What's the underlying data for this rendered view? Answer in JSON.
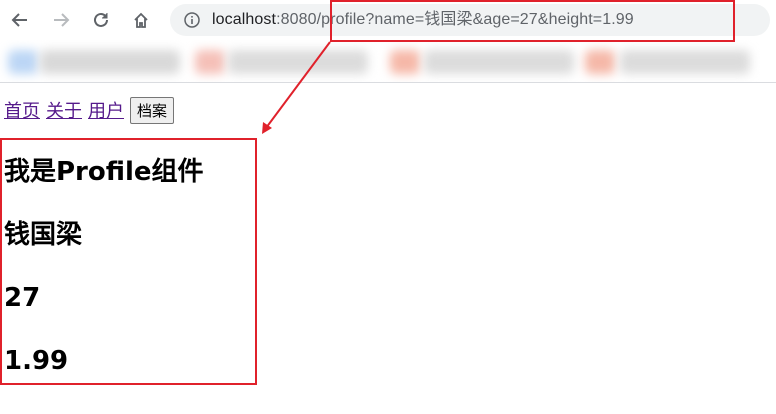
{
  "browser": {
    "url_host": "localhost",
    "url_path": ":8080/profile?name=钱国梁&age=27&height=1.99",
    "icons": {
      "back": "back-arrow-icon",
      "forward": "forward-arrow-icon",
      "reload": "reload-icon",
      "home": "home-icon",
      "info": "info-icon"
    }
  },
  "nav": {
    "links": [
      "首页",
      "关于",
      "用户"
    ],
    "button_label": "档案"
  },
  "profile": {
    "heading": "我是Profile组件",
    "name": "钱国梁",
    "age": "27",
    "height": "1.99"
  },
  "colors": {
    "annotation_red": "#e0212b",
    "visited_link": "#551a8b"
  }
}
